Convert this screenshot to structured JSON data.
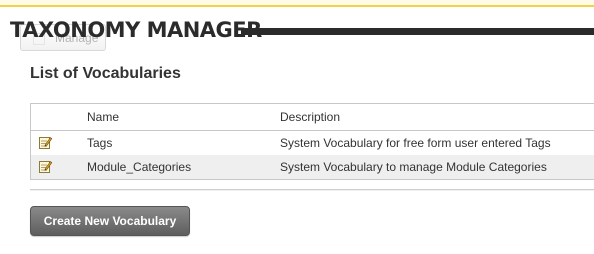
{
  "header": {
    "ghost_button_label": "Manage",
    "title": "TAXONOMY MANAGER"
  },
  "section": {
    "title": "List of Vocabularies"
  },
  "table": {
    "columns": [
      "",
      "Name",
      "Description"
    ],
    "rows": [
      {
        "name": "Tags",
        "description": "System Vocabulary for free form user entered Tags"
      },
      {
        "name": "Module_Categories",
        "description": "System Vocabulary to manage Module Categories"
      }
    ]
  },
  "actions": {
    "create_label": "Create New Vocabulary"
  },
  "colors": {
    "accent_yellow": "#f0d24a",
    "header_dark": "#2b2b2b",
    "button_gray": "#6e6e6e",
    "row_alt": "#efefef"
  },
  "icons": {
    "edit": "edit-pencil-icon"
  }
}
